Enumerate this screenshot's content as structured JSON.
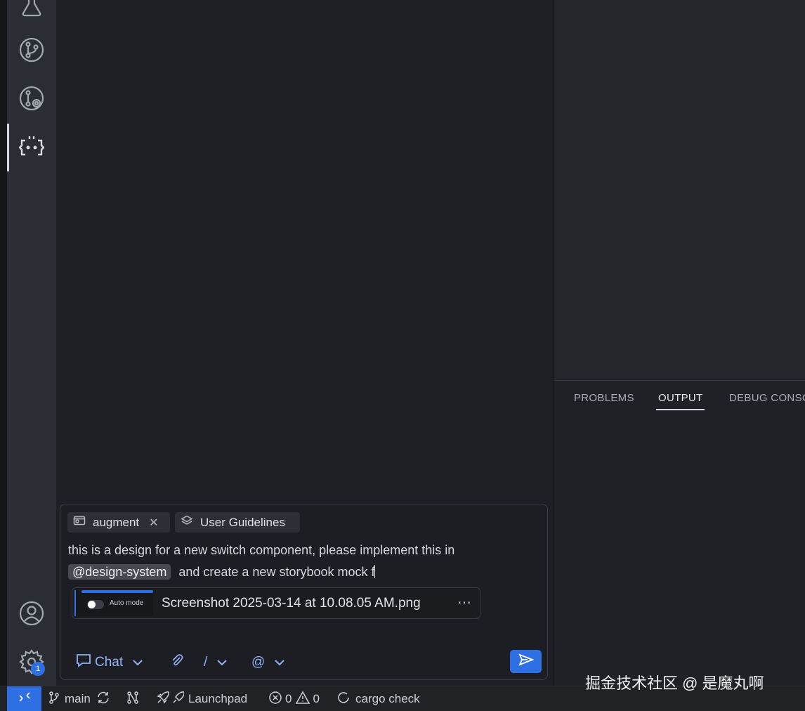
{
  "activity_bar": {
    "settings_badge": "1",
    "icons": [
      "flask-icon",
      "source-control-icon",
      "git-graph-icon",
      "augment-icon",
      "account-icon",
      "settings-gear-icon"
    ]
  },
  "panel": {
    "tabs": [
      "PROBLEMS",
      "OUTPUT",
      "DEBUG CONSOLE"
    ],
    "active_tab": "OUTPUT"
  },
  "chat": {
    "chips": [
      {
        "label": "augment",
        "icon": "folder-icon"
      },
      {
        "label": "User Guidelines",
        "icon": "layers-icon"
      }
    ],
    "message_line1": "this is a design for a new switch component, please implement this in",
    "mention": "@design-system",
    "message_line2_rest": "and create a new storybook mock f",
    "attachment": {
      "thumb_label": "Auto mode",
      "filename": "Screenshot 2025-03-14 at 10.08.05 AM.png"
    },
    "mode_label": "Chat",
    "slash_label": "/",
    "at_label": "@"
  },
  "status_bar": {
    "branch": "main",
    "launchpad": "Launchpad",
    "errors": "0",
    "warnings": "0",
    "task": "cargo check"
  },
  "watermark": "掘金技术社区 @ 是魔丸啊",
  "colors": {
    "accent": "#2f6fe4",
    "activity_bar": "#2a2d33",
    "editor_bg": "#1e1f24"
  }
}
